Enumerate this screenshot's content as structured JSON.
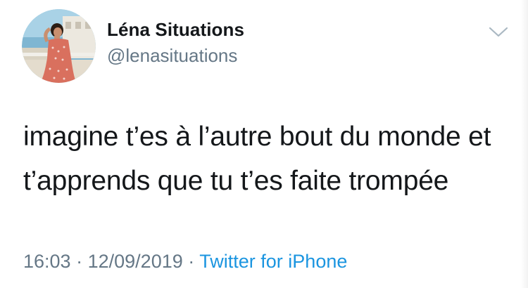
{
  "author": {
    "display_name": "Léna Situations",
    "handle": "@lenasituations",
    "avatar_icon": "profile-photo"
  },
  "tweet": {
    "lines": [
      "imagine t’es à l’autre bout du monde et",
      "t’apprends que tu t’es faite trompée"
    ]
  },
  "meta": {
    "time": "16:03",
    "separator": "·",
    "date": "12/09/2019",
    "source": "Twitter for iPhone"
  },
  "menu": {
    "icon": "chevron-down-icon"
  },
  "colors": {
    "text": "#14171a",
    "secondary": "#657786",
    "link": "#1b95e0"
  }
}
